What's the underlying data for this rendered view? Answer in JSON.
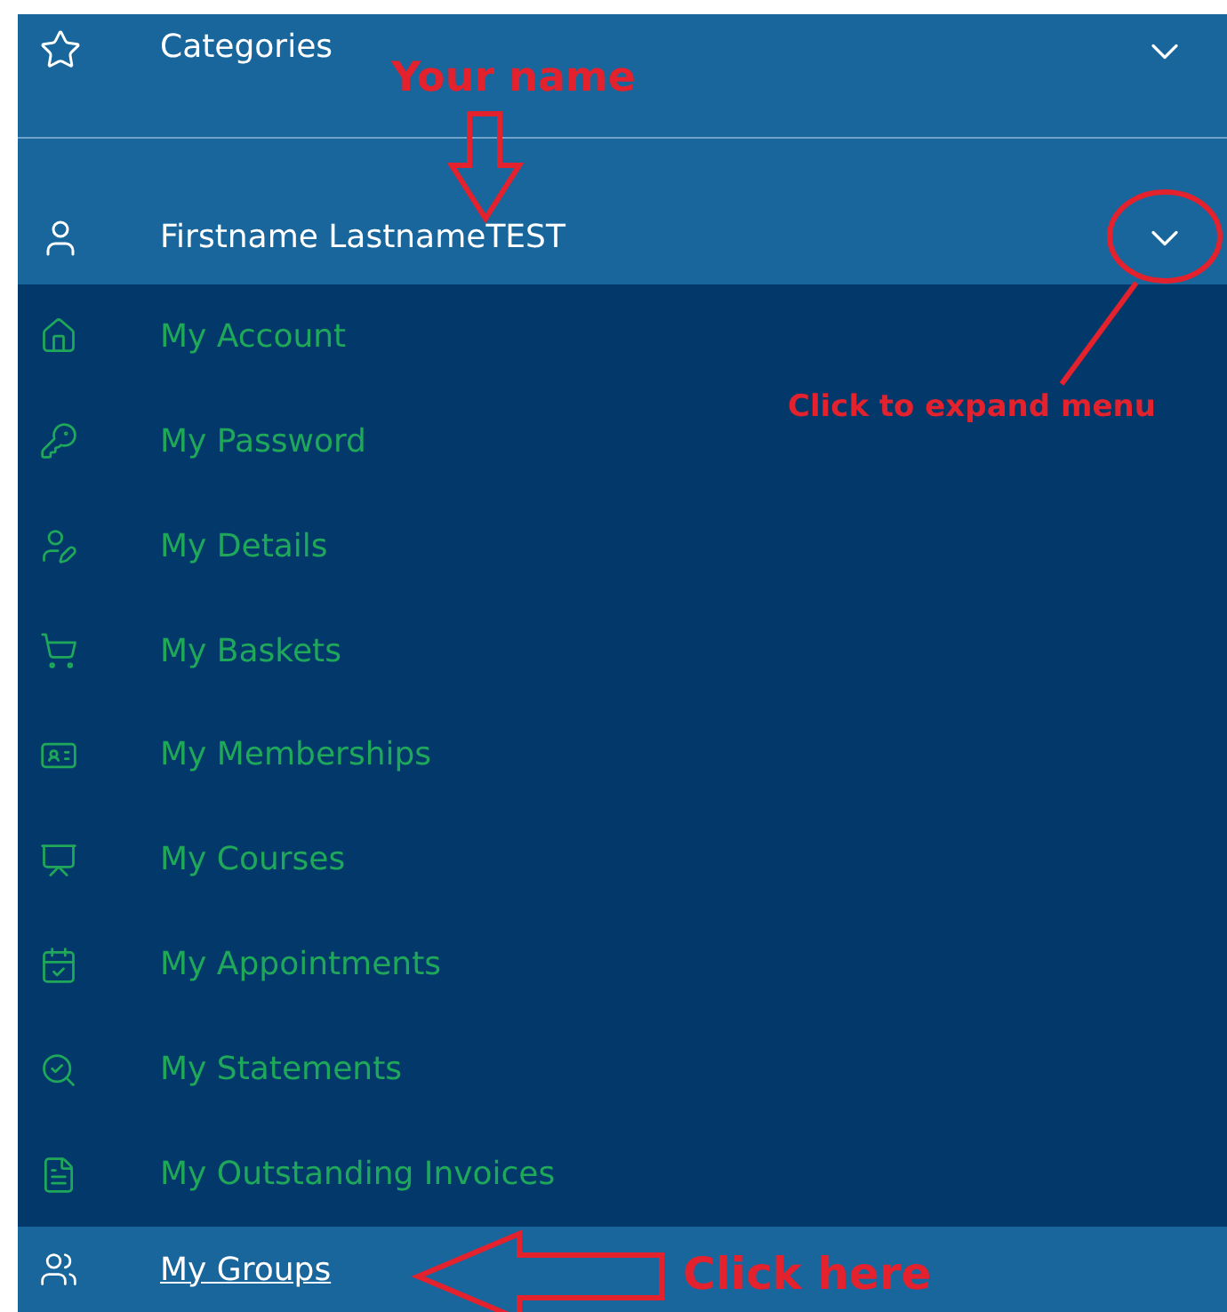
{
  "categories": {
    "label": "Categories"
  },
  "user": {
    "name": "Firstname LastnameTEST",
    "expanded": true
  },
  "menu_items": [
    {
      "label": "My Account",
      "selected": false
    },
    {
      "label": "My Password",
      "selected": false
    },
    {
      "label": "My Details",
      "selected": false
    },
    {
      "label": "My Baskets",
      "selected": false
    },
    {
      "label": "My Memberships",
      "selected": false
    },
    {
      "label": "My Courses",
      "selected": false
    },
    {
      "label": "My Appointments",
      "selected": false
    },
    {
      "label": "My Statements",
      "selected": false
    },
    {
      "label": "My Outstanding Invoices",
      "selected": false
    },
    {
      "label": "My Groups",
      "selected": true
    }
  ],
  "annotations": {
    "name_hint": "Your name",
    "expand_hint": "Click to expand menu",
    "click_hint": "Click here"
  }
}
